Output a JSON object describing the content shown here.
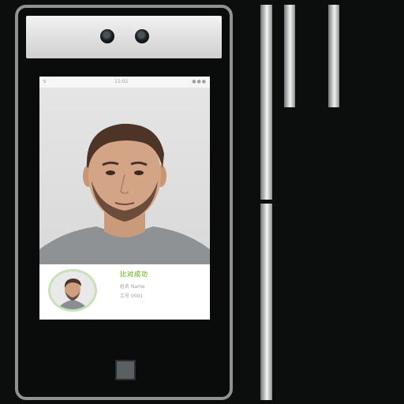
{
  "screen": {
    "status_left": "↯",
    "status_center": "11:02",
    "status_right": "●●●",
    "result_status": "比对成功",
    "result_name_line": "姓名 Name",
    "result_id_line": "工号 0001"
  },
  "icons": [
    "camera-icon",
    "camera-icon",
    "fingerprint-sensor-icon"
  ],
  "colors": {
    "accent": "#8bc34a",
    "frame": "#8e9293",
    "background": "#0b0e0d"
  }
}
